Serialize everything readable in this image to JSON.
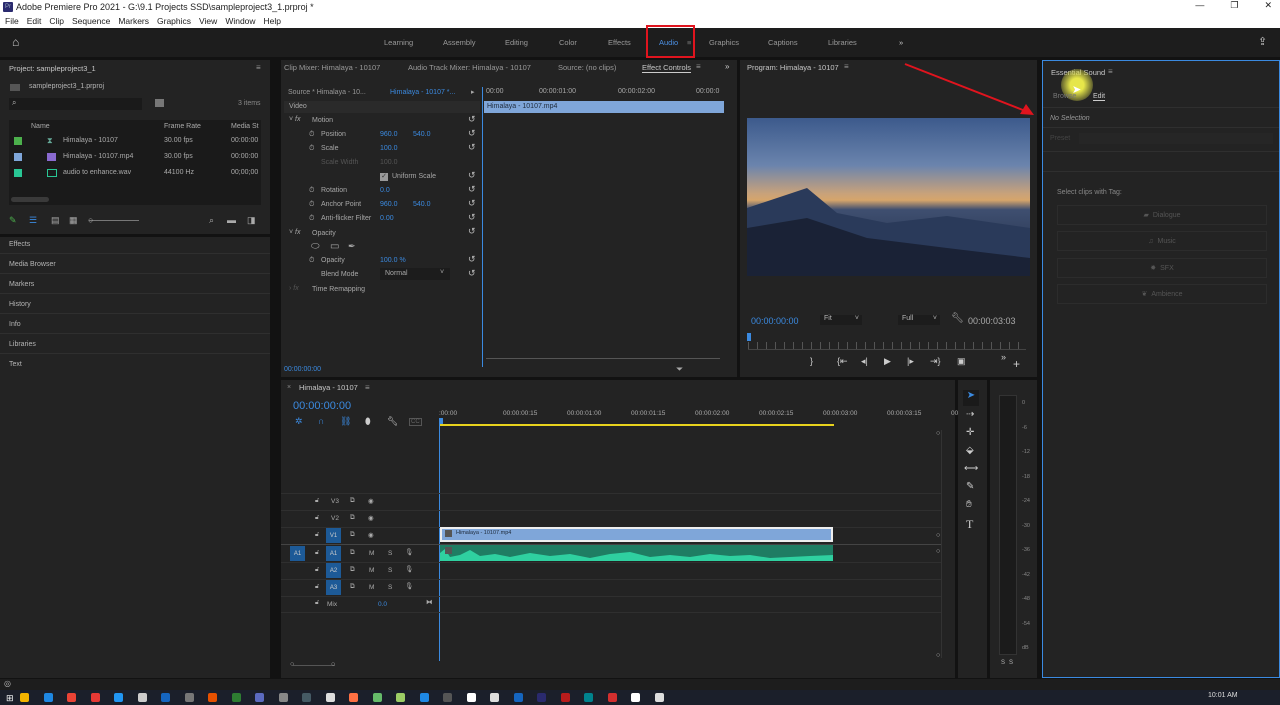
{
  "window": {
    "title": "Adobe Premiere Pro 2021 - G:\\9.1 Projects SSD\\sampleproject3_1.prproj *",
    "app_icon": "Pr",
    "controls": [
      "—",
      "❐",
      "✕"
    ]
  },
  "menu": [
    "File",
    "Edit",
    "Clip",
    "Sequence",
    "Markers",
    "Graphics",
    "View",
    "Window",
    "Help"
  ],
  "workspaces": {
    "items": [
      "Learning",
      "Assembly",
      "Editing",
      "Color",
      "Effects",
      "Audio",
      "Graphics",
      "Captions",
      "Libraries"
    ],
    "active": "Audio",
    "more": "»"
  },
  "project": {
    "title": "Project: sampleproject3_1",
    "file": "sampleproject3_1.prproj",
    "item_count": "3 items",
    "columns": [
      "Name",
      "Frame Rate",
      "Media St"
    ],
    "items": [
      {
        "name": "Himalaya - 10107",
        "rate": "30.00 fps",
        "start": "00:00:00",
        "color": "#4cb04c"
      },
      {
        "name": "Himalaya - 10107.mp4",
        "rate": "30.00 fps",
        "start": "00:00:00",
        "color": "#7fa6d9"
      },
      {
        "name": "audio to enhance.wav",
        "rate": "44100 Hz",
        "start": "00;00;00",
        "color": "#29c795"
      }
    ]
  },
  "left_panels": [
    "Effects",
    "Media Browser",
    "Markers",
    "History",
    "Info",
    "Libraries",
    "Text"
  ],
  "tabs": {
    "clip_mixer": "Clip Mixer: Himalaya - 10107",
    "audio_track_mixer": "Audio Track Mixer: Himalaya - 10107",
    "source": "Source: (no clips)",
    "effect_controls": "Effect Controls"
  },
  "effect_controls": {
    "source": "Source * Himalaya - 10...",
    "sequence": "Himalaya - 10107 *...",
    "section": "Video",
    "ruler": [
      "00:00",
      "00:00:01:00",
      "00:00:02:00",
      "00:00:0"
    ],
    "clip": "Himalaya - 10107.mp4",
    "motion": "Motion",
    "position": {
      "label": "Position",
      "x": "960.0",
      "y": "540.0"
    },
    "scale": {
      "label": "Scale",
      "value": "100.0"
    },
    "scale_width": {
      "label": "Scale Width",
      "value": "100.0"
    },
    "uniform_scale": "Uniform Scale",
    "rotation": {
      "label": "Rotation",
      "value": "0.0"
    },
    "anchor": {
      "label": "Anchor Point",
      "x": "960.0",
      "y": "540.0"
    },
    "antiflicker": {
      "label": "Anti-flicker Filter",
      "value": "0.00"
    },
    "opacity_section": "Opacity",
    "opacity": {
      "label": "Opacity",
      "value": "100.0 %"
    },
    "blend": {
      "label": "Blend Mode",
      "value": "Normal"
    },
    "time_remap": "Time Remapping",
    "timecode": "00:00:00:00"
  },
  "program": {
    "title": "Program: Himalaya - 10107",
    "timecode": "00:00:00:00",
    "fit": "Fit",
    "quality": "Full",
    "duration": "00:00:03:03"
  },
  "essential_sound": {
    "title": "Essential Sound",
    "tabs": [
      "Browse",
      "Edit"
    ],
    "active_tab": "Edit",
    "no_selection": "No Selection",
    "preset": "Preset",
    "select_label": "Select clips with Tag:",
    "tags": [
      "Dialogue",
      "Music",
      "SFX",
      "Ambience"
    ]
  },
  "timeline": {
    "title": "Himalaya - 10107",
    "timecode": "00:00:00:00",
    "ruler": [
      ":00:00",
      "00:00:00:15",
      "00:00:01:00",
      "00:00:01:15",
      "00:00:02:00",
      "00:00:02:15",
      "00:00:03:00",
      "00:00:03:15",
      "00"
    ],
    "video_tracks": [
      "V3",
      "V2",
      "V1"
    ],
    "audio_tracks": [
      "A1",
      "A2",
      "A3"
    ],
    "source_patch": "A1",
    "mix": {
      "label": "Mix",
      "value": "0.0"
    },
    "video_clip": "Himalaya - 10107.mp4",
    "m": "M",
    "s": "S"
  },
  "meter": {
    "scale": [
      "0",
      "-6",
      "-12",
      "-18",
      "-24",
      "-30",
      "-36",
      "-42",
      "-48",
      "-54",
      "dB"
    ],
    "solo": [
      "S",
      "S"
    ]
  },
  "taskbar": {
    "clock": "10:01 AM"
  },
  "colors": {
    "accent": "#3b8ae0",
    "audio_clip": "#1fa582",
    "video_clip": "#7fa6d9",
    "highlight": "#e0141e"
  }
}
